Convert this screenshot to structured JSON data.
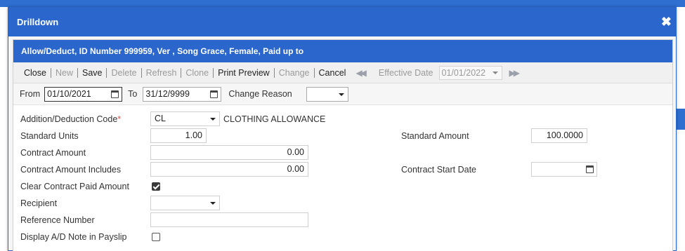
{
  "dialog": {
    "title": "Drilldown",
    "close_icon": "close-icon"
  },
  "panel": {
    "header": "Allow/Deduct, ID Number 999959, Ver , Song Grace, Female, Paid up to"
  },
  "toolbar": {
    "close": "Close",
    "new": "New",
    "save": "Save",
    "delete": "Delete",
    "refresh": "Refresh",
    "clone": "Clone",
    "print_preview": "Print Preview",
    "change": "Change",
    "cancel": "Cancel",
    "effective_date_label": "Effective Date",
    "effective_date_value": "01/01/2022",
    "nav_prev_icon": "double-chevron-left-icon",
    "nav_next_icon": "double-chevron-right-icon"
  },
  "date_row": {
    "from_label": "From",
    "from_value": "01/10/2021",
    "to_label": "To",
    "to_value": "31/12/9999",
    "change_reason_label": "Change Reason",
    "change_reason_value": ""
  },
  "form": {
    "ad_code_label": "Addition/Deduction Code",
    "ad_code_required": "*",
    "ad_code_value": "CL",
    "ad_code_desc": "CLOTHING ALLOWANCE",
    "standard_units_label": "Standard Units",
    "standard_units_value": "1.00",
    "standard_amount_label": "Standard Amount",
    "standard_amount_value": "100.0000",
    "contract_amount_label": "Contract Amount",
    "contract_amount_value": "0.00",
    "contract_amount_includes_label": "Contract Amount Includes",
    "contract_amount_includes_value": "0.00",
    "contract_start_date_label": "Contract Start Date",
    "contract_start_date_value": "",
    "clear_contract_paid_label": "Clear Contract Paid Amount",
    "clear_contract_paid_checked": true,
    "recipient_label": "Recipient",
    "recipient_value": "",
    "reference_number_label": "Reference Number",
    "reference_number_value": "",
    "display_note_label": "Display A/D Note in Payslip",
    "display_note_checked": false
  },
  "colors": {
    "accent": "#2a66cc",
    "required": "#d9534f"
  }
}
